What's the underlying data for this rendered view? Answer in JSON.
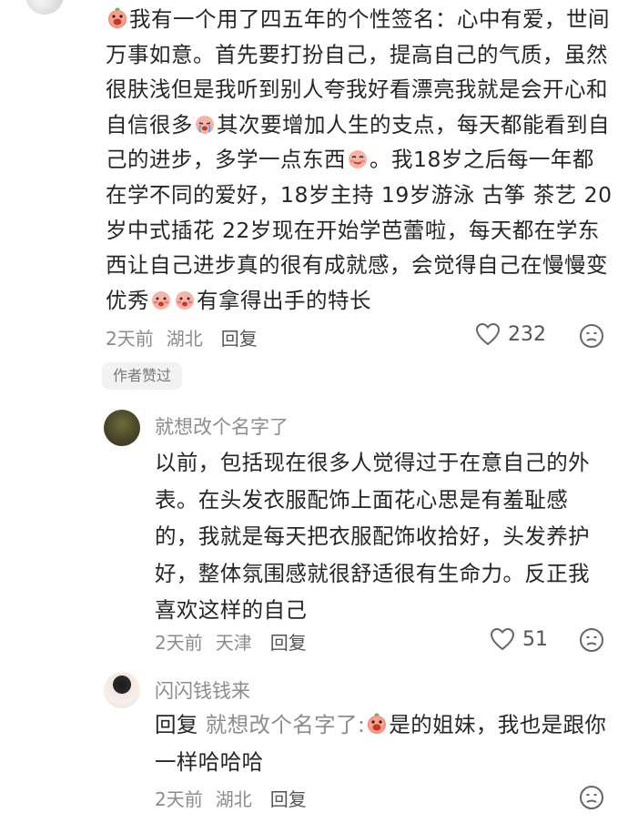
{
  "comment": {
    "text_1": "我有一个用了四五年的个性签名：心中有爱，世间万事如意。首先要打扮自己，提高自己的气质，虽然很肤浅但是我听到别人夸我好看漂亮我就是会开心和自信很多",
    "text_2": "其次要增加人生的支点，每天都能看到自己的进步，多学一点东西",
    "text_3": "。我18岁之后每一年都在学不同的爱好，18岁主持 19岁游泳 古筝 茶艺 20岁中式插花 22岁现在开始学芭蕾啦，每天都在学东西让自己进步真的很有成就感，会觉得自己在慢慢变优秀",
    "text_4": "有拿得出手的特长",
    "time": "2天前",
    "location": "湖北",
    "reply_label": "回复",
    "likes": "232",
    "author_liked_badge": "作者赞过"
  },
  "replies": [
    {
      "username": "就想改个名字了",
      "text": "以前，包括现在很多人觉得过于在意自己的外表。在头发衣服配饰上面花心思是有羞耻感的，我就是每天把衣服配饰收拾好，头发养护好，整体氛围感就很舒适很有生命力。反正我喜欢这样的自己",
      "time": "2天前",
      "location": "天津",
      "reply_label": "回复",
      "likes": "51"
    },
    {
      "username": "闪闪钱钱来",
      "prefix": "回复",
      "mention": "就想改个名字了:",
      "text": "是的姐妹，我也是跟你一样哈哈哈",
      "time": "2天前",
      "location": "湖北",
      "reply_label": "回复"
    }
  ],
  "icons": {
    "like": "heart-outline-icon",
    "dislike": "sad-face-icon",
    "emoji_1": "grinning-sticker-emoji",
    "emoji_2": "crying-sticker-emoji",
    "emoji_3": "shy-sticker-emoji",
    "emoji_4": "blushing-sticker-emoji"
  }
}
